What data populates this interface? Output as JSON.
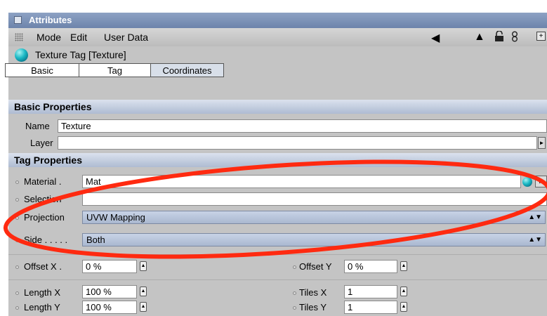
{
  "window": {
    "title": "Attributes"
  },
  "menubar": {
    "items": [
      "Mode",
      "Edit",
      "User Data"
    ],
    "icons": [
      "back-arrow-icon",
      "up-arrow-icon",
      "lock-icon",
      "chain-icon",
      "new-panel-icon"
    ]
  },
  "object": {
    "title": "Texture Tag [Texture]",
    "icon": "material-sphere-icon"
  },
  "tabs": [
    "Basic",
    "Tag",
    "Coordinates"
  ],
  "basic": {
    "header": "Basic Properties",
    "name_label": "Name",
    "name_value": "Texture",
    "layer_label": "Layer",
    "layer_value": ""
  },
  "tag": {
    "header": "Tag Properties",
    "material_label": "Material .",
    "material_value": "Mat",
    "selection_label": "Selection",
    "selection_value": "",
    "projection_label": "Projection",
    "projection_value": "UVW Mapping",
    "side_label": "Side . . . . .",
    "side_value": "Both",
    "offset_x_label": "Offset X .",
    "offset_x_value": "0 %",
    "offset_y_label": "Offset Y",
    "offset_y_value": "0 %",
    "length_x_label": "Length X",
    "length_x_value": "100 %",
    "length_y_label": "Length Y",
    "length_y_value": "100 %",
    "tiles_x_label": "Tiles X",
    "tiles_x_value": "1",
    "tiles_y_label": "Tiles Y",
    "tiles_y_value": "1"
  },
  "colors": {
    "annotation": "#ff2a10",
    "header": "#aebbd2",
    "titlebar": "#7a8fb5"
  }
}
